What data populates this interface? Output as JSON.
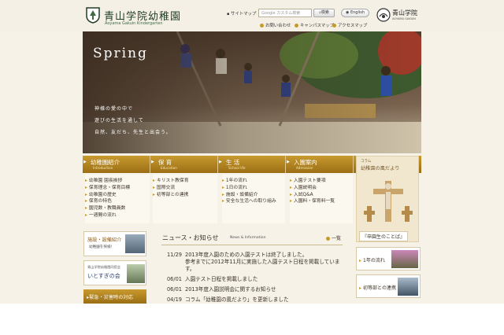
{
  "header": {
    "brand_title": "青山学院幼稚園",
    "brand_sub": "Aoyama Gakuin Kindergarten",
    "sitemap": "サイトマップ",
    "search_placeholder": "Google カスタム検索",
    "search_button": "検索",
    "english": "English",
    "links": [
      "お問い合わせ",
      "キャンパスマップ",
      "アクセスマップ"
    ],
    "aoyama_name": "青山学院",
    "aoyama_sub": "AOYAMA GAKUIN"
  },
  "hero": {
    "title": "Spring",
    "lines": [
      "神様の愛の中で",
      "遊びの生活を通して",
      "自然、友だち、先生と出会う。"
    ]
  },
  "nav": [
    {
      "label": "幼稚園紹介",
      "en": "Introduction",
      "items": [
        "幼稚園 園長挨拶",
        "保育理念・保育目標",
        "幼稚園の歴史",
        "保育の特色",
        "園児数・教職員数",
        "一週間の流れ"
      ]
    },
    {
      "label": "保 育",
      "en": "Education",
      "items": [
        "キリスト教保育",
        "国際交流",
        "初等部との連携"
      ]
    },
    {
      "label": "生 活",
      "en": "School life",
      "items": [
        "1年の流れ",
        "1日の流れ",
        "施設・設備紹介",
        "安全な生活への取り組み"
      ]
    },
    {
      "label": "入園案内",
      "en": "Admission",
      "items": [
        "入園テスト要項",
        "入園説明会",
        "入試Q&A",
        "入園料・保育料一覧"
      ]
    }
  ],
  "column": {
    "label_small": "コラム",
    "title": "幼稚園の風だより",
    "graduate": "『卒園生のことば』"
  },
  "side": {
    "facilities_title": "施設・設備紹介",
    "facilities_sub": "幼稚園を探検！",
    "alumni_small": "青山学院幼稚園同窓会",
    "alumni_title": "いとすぎの会",
    "emergency": "緊急・災害時の対応"
  },
  "news": {
    "title": "ニュース・お知らせ",
    "title_en": "News & Information",
    "more": "一覧",
    "items": [
      {
        "date": "11/29",
        "text": "2013年度入園のための入園テストは終了しました。",
        "text2": "参考までに2012年11月に実施した入園テスト日程を掲載していま",
        "text3": "す。"
      },
      {
        "date": "06/01",
        "text": "入園テスト日程を掲載しました"
      },
      {
        "date": "06/01",
        "text": "2013年度入園説明会に関するお知らせ"
      },
      {
        "date": "04/19",
        "text": "コラム「幼稚園の風だより」を更新しました"
      }
    ]
  },
  "right": {
    "year_flow": "1年の流れ",
    "elementary": "初等部との連携"
  },
  "colors": {
    "accent": "#c49a2a",
    "brand_green": "#213f25",
    "nav_gold": "#b8861f"
  }
}
